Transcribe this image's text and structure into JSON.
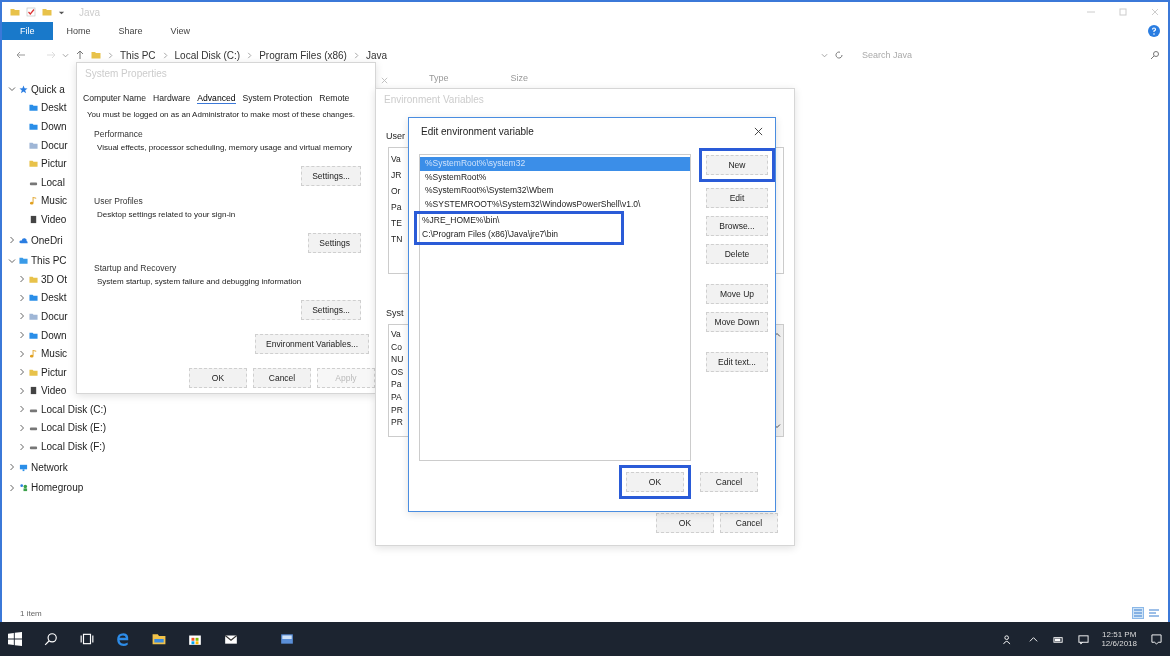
{
  "explorer": {
    "title": "Java",
    "ribbon_tabs": [
      {
        "label": "File",
        "selected": true
      },
      {
        "label": "Home",
        "selected": false
      },
      {
        "label": "Share",
        "selected": false
      },
      {
        "label": "View",
        "selected": false
      }
    ],
    "breadcrumb": [
      "This PC",
      "Local Disk (C:)",
      "Program Files (x86)",
      "Java"
    ],
    "search": {
      "placeholder": "Search Java"
    },
    "columns": [
      "Type",
      "Size"
    ],
    "sidebar": [
      {
        "label": "Quick a",
        "kind": "star",
        "expanded": true,
        "children": [
          {
            "label": "Deskt",
            "kind": "desktop"
          },
          {
            "label": "Down",
            "kind": "download"
          },
          {
            "label": "Docur",
            "kind": "document"
          },
          {
            "label": "Pictur",
            "kind": "picture"
          },
          {
            "label": "Local",
            "kind": "drive"
          },
          {
            "label": "Music",
            "kind": "music"
          },
          {
            "label": "Video",
            "kind": "video"
          }
        ]
      },
      {
        "label": "OneDri",
        "kind": "cloud",
        "expanded": false
      },
      {
        "label": "This PC",
        "kind": "pc",
        "expanded": true,
        "children": [
          {
            "label": "3D Ot",
            "kind": "folder",
            "expanded": false
          },
          {
            "label": "Deskt",
            "kind": "desktop",
            "expanded": false
          },
          {
            "label": "Docur",
            "kind": "document",
            "expanded": false
          },
          {
            "label": "Down",
            "kind": "download",
            "expanded": false
          },
          {
            "label": "Music",
            "kind": "music",
            "expanded": false
          },
          {
            "label": "Pictur",
            "kind": "picture",
            "expanded": false
          },
          {
            "label": "Video",
            "kind": "video",
            "expanded": false
          },
          {
            "label": "Local Disk (C:)",
            "kind": "drive",
            "expanded": false
          },
          {
            "label": "Local Disk (E:)",
            "kind": "drive",
            "expanded": false
          },
          {
            "label": "Local Disk (F:)",
            "kind": "drive",
            "expanded": false
          }
        ]
      },
      {
        "label": "Network",
        "kind": "network",
        "expanded": false
      },
      {
        "label": "Homegroup",
        "kind": "homegroup",
        "expanded": false
      }
    ],
    "status": "1 item"
  },
  "system_properties": {
    "title": "System Properties",
    "tabs": [
      {
        "label": "Computer Name",
        "selected": false
      },
      {
        "label": "Hardware",
        "selected": false
      },
      {
        "label": "Advanced",
        "selected": true
      },
      {
        "label": "System Protection",
        "selected": false
      },
      {
        "label": "Remote",
        "selected": false
      }
    ],
    "notice": "You must be logged on as an Administrator to make most of these changes.",
    "groups": [
      {
        "heading": "Performance",
        "description": "Visual effects, processor scheduling, memory usage and virtual memory",
        "button": "Settings..."
      },
      {
        "heading": "User Profiles",
        "description": "Desktop settings related to your sign-in",
        "button": "Settings"
      },
      {
        "heading": "Startup and Recovery",
        "description": "System startup, system failure and debugging information",
        "button": "Settings..."
      }
    ],
    "env_button": "Environment Variables...",
    "buttons": [
      {
        "label": "OK",
        "disabled": false
      },
      {
        "label": "Cancel",
        "disabled": false
      },
      {
        "label": "Apply",
        "disabled": true
      }
    ]
  },
  "environment_variables": {
    "title": "Environment Variables",
    "user_label": "User",
    "user_rows": [
      "Va",
      "JR",
      "Or",
      "Pa",
      "TE",
      "TN"
    ],
    "system_label": "Syst",
    "system_rows": [
      "Va",
      "Co",
      "NU",
      "OS",
      "Pa",
      "PA",
      "PR",
      "PR"
    ],
    "buttons": [
      "OK",
      "Cancel"
    ]
  },
  "edit_variable": {
    "title": "Edit environment variable",
    "entries": [
      {
        "text": "%SystemRoot%\\system32",
        "selected": true,
        "highlighted": false
      },
      {
        "text": "%SystemRoot%",
        "selected": false,
        "highlighted": false
      },
      {
        "text": "%SystemRoot%\\System32\\Wbem",
        "selected": false,
        "highlighted": false
      },
      {
        "text": "%SYSTEMROOT%\\System32\\WindowsPowerShell\\v1.0\\",
        "selected": false,
        "highlighted": false
      },
      {
        "text": "%JRE_HOME%\\bin\\",
        "selected": false,
        "highlighted": true
      },
      {
        "text": "C:\\Program Files (x86)\\Java\\jre7\\bin",
        "selected": false,
        "highlighted": true
      }
    ],
    "buttons": [
      {
        "label": "New",
        "highlighted": true
      },
      {
        "label": "Edit",
        "highlighted": false
      },
      {
        "label": "Browse...",
        "highlighted": false
      },
      {
        "label": "Delete",
        "highlighted": false
      },
      {
        "label": "Move Up",
        "highlighted": false
      },
      {
        "label": "Move Down",
        "highlighted": false
      },
      {
        "label": "Edit text...",
        "highlighted": false
      }
    ],
    "footer_buttons": [
      {
        "label": "OK",
        "highlighted": true
      },
      {
        "label": "Cancel",
        "highlighted": false
      }
    ]
  },
  "taskbar": {
    "time": "12:51 PM",
    "date": "12/6/2018"
  }
}
